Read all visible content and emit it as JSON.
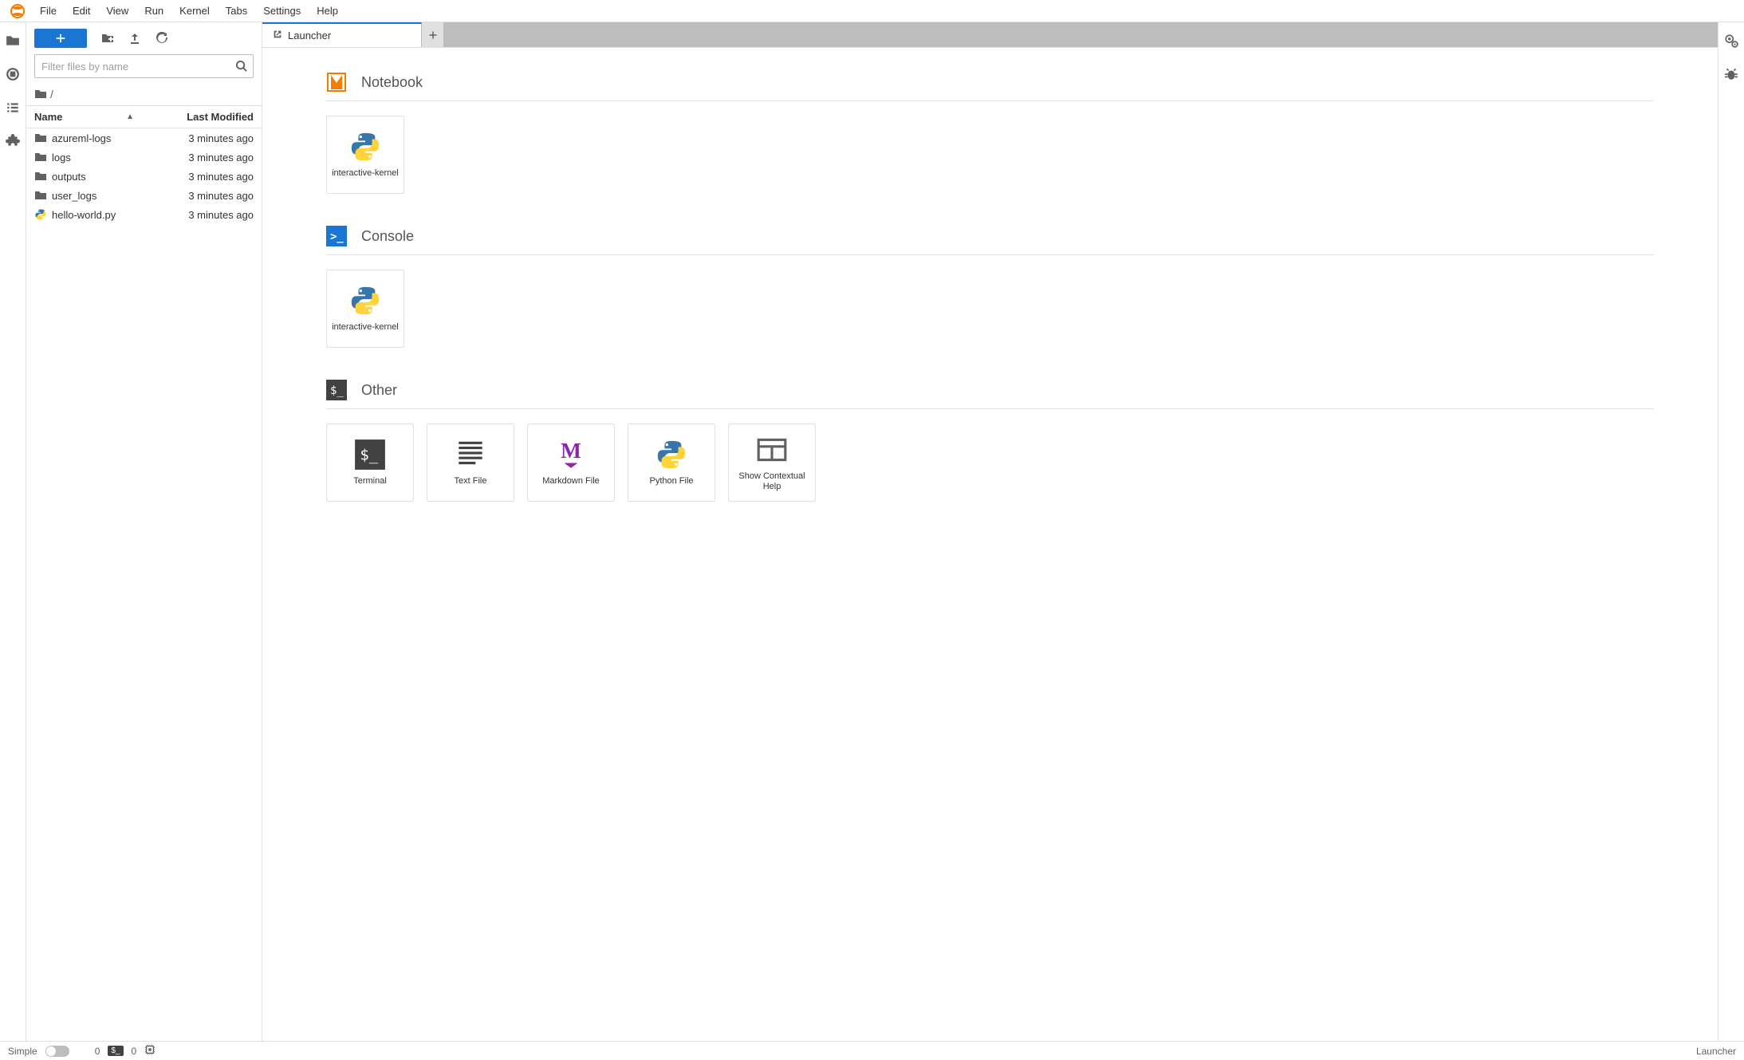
{
  "menu": {
    "items": [
      "File",
      "Edit",
      "View",
      "Run",
      "Kernel",
      "Tabs",
      "Settings",
      "Help"
    ]
  },
  "filebrowser": {
    "filter_placeholder": "Filter files by name",
    "breadcrumb": "/",
    "header_name": "Name",
    "header_modified": "Last Modified",
    "items": [
      {
        "name": "azureml-logs",
        "modified": "3 minutes ago",
        "type": "folder"
      },
      {
        "name": "logs",
        "modified": "3 minutes ago",
        "type": "folder"
      },
      {
        "name": "outputs",
        "modified": "3 minutes ago",
        "type": "folder"
      },
      {
        "name": "user_logs",
        "modified": "3 minutes ago",
        "type": "folder"
      },
      {
        "name": "hello-world.py",
        "modified": "3 minutes ago",
        "type": "python"
      }
    ]
  },
  "tab": {
    "title": "Launcher"
  },
  "launcher": {
    "sections": {
      "notebook": {
        "title": "Notebook",
        "cards": [
          {
            "label": "interactive-kernel",
            "kind": "python"
          }
        ]
      },
      "console": {
        "title": "Console",
        "cards": [
          {
            "label": "interactive-kernel",
            "kind": "python"
          }
        ]
      },
      "other": {
        "title": "Other",
        "cards": [
          {
            "label": "Terminal",
            "kind": "terminal"
          },
          {
            "label": "Text File",
            "kind": "text"
          },
          {
            "label": "Markdown File",
            "kind": "markdown"
          },
          {
            "label": "Python File",
            "kind": "python"
          },
          {
            "label": "Show Contextual Help",
            "kind": "help"
          }
        ]
      }
    }
  },
  "statusbar": {
    "simple_label": "Simple",
    "terminals": "0",
    "kernels": "0",
    "mode": "Launcher"
  }
}
